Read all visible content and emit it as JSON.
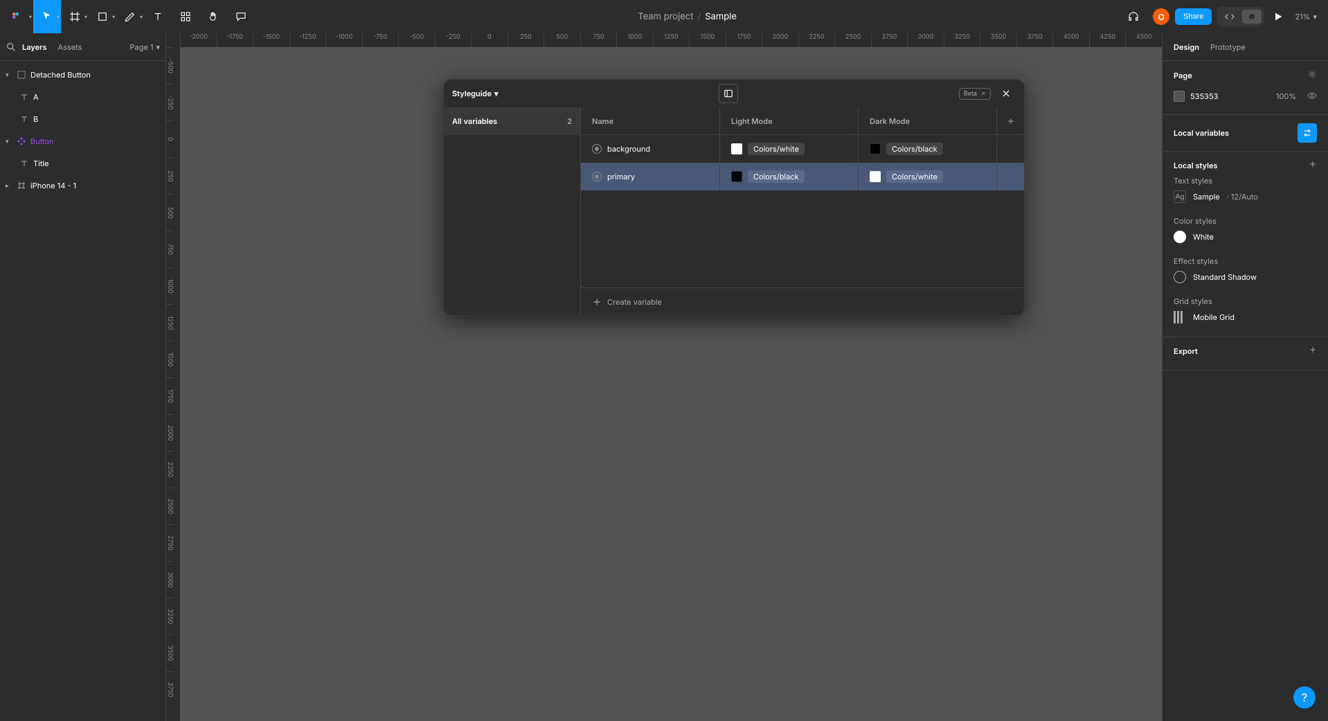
{
  "toolbar": {
    "project": "Team project",
    "file": "Sample",
    "share_label": "Share",
    "zoom": "21%",
    "avatar_initial": "O"
  },
  "left_panel": {
    "tabs": {
      "layers": "Layers",
      "assets": "Assets"
    },
    "page_label": "Page 1",
    "tree": [
      {
        "label": "Detached Button",
        "icon": "group",
        "indent": 0,
        "expanded": true
      },
      {
        "label": "A",
        "icon": "text",
        "indent": 1
      },
      {
        "label": "B",
        "icon": "text",
        "indent": 1
      },
      {
        "label": "Button",
        "icon": "component",
        "indent": 0,
        "expanded": true
      },
      {
        "label": "Title",
        "icon": "text",
        "indent": 1
      },
      {
        "label": "iPhone 14 - 1",
        "icon": "frame",
        "indent": 0,
        "expanded": false
      }
    ]
  },
  "ruler_h": [
    "-2000",
    "-1750",
    "-1500",
    "-1250",
    "-1000",
    "-750",
    "-500",
    "-250",
    "0",
    "250",
    "500",
    "750",
    "1000",
    "1250",
    "1500",
    "1750",
    "2000",
    "2250",
    "2500",
    "2750",
    "3000",
    "3250",
    "3500",
    "3750",
    "4000",
    "4250",
    "4500"
  ],
  "ruler_v": [
    "-500",
    "-250",
    "0",
    "250",
    "500",
    "750",
    "1000",
    "1250",
    "1500",
    "1750",
    "2000",
    "2250",
    "2500",
    "2750",
    "3000",
    "3250",
    "3500",
    "3750"
  ],
  "vars_modal": {
    "title": "Styleguide",
    "beta_label": "Beta",
    "collection": {
      "name": "All variables",
      "count": "2"
    },
    "columns": {
      "name": "Name",
      "light": "Light Mode",
      "dark": "Dark Mode"
    },
    "rows": [
      {
        "name": "background",
        "light": {
          "color": "#ffffff",
          "alias": "Colors/white"
        },
        "dark": {
          "color": "#000000",
          "alias": "Colors/black"
        },
        "selected": false
      },
      {
        "name": "primary",
        "light": {
          "color": "#000000",
          "alias": "Colors/black"
        },
        "dark": {
          "color": "#ffffff",
          "alias": "Colors/white"
        },
        "selected": true
      }
    ],
    "create_label": "Create variable"
  },
  "right_panel": {
    "tabs": {
      "design": "Design",
      "prototype": "Prototype"
    },
    "page": {
      "title": "Page",
      "bg_hex": "535353",
      "bg_pct": "100%"
    },
    "local_variables": "Local variables",
    "local_styles": "Local styles",
    "text_styles": {
      "title": "Text styles",
      "item_name": "Sample",
      "item_meta": "12/Auto"
    },
    "color_styles": {
      "title": "Color styles",
      "item_name": "White"
    },
    "effect_styles": {
      "title": "Effect styles",
      "item_name": "Standard Shadow"
    },
    "grid_styles": {
      "title": "Grid styles",
      "item_name": "Mobile Grid"
    },
    "export": "Export"
  },
  "help_label": "?"
}
